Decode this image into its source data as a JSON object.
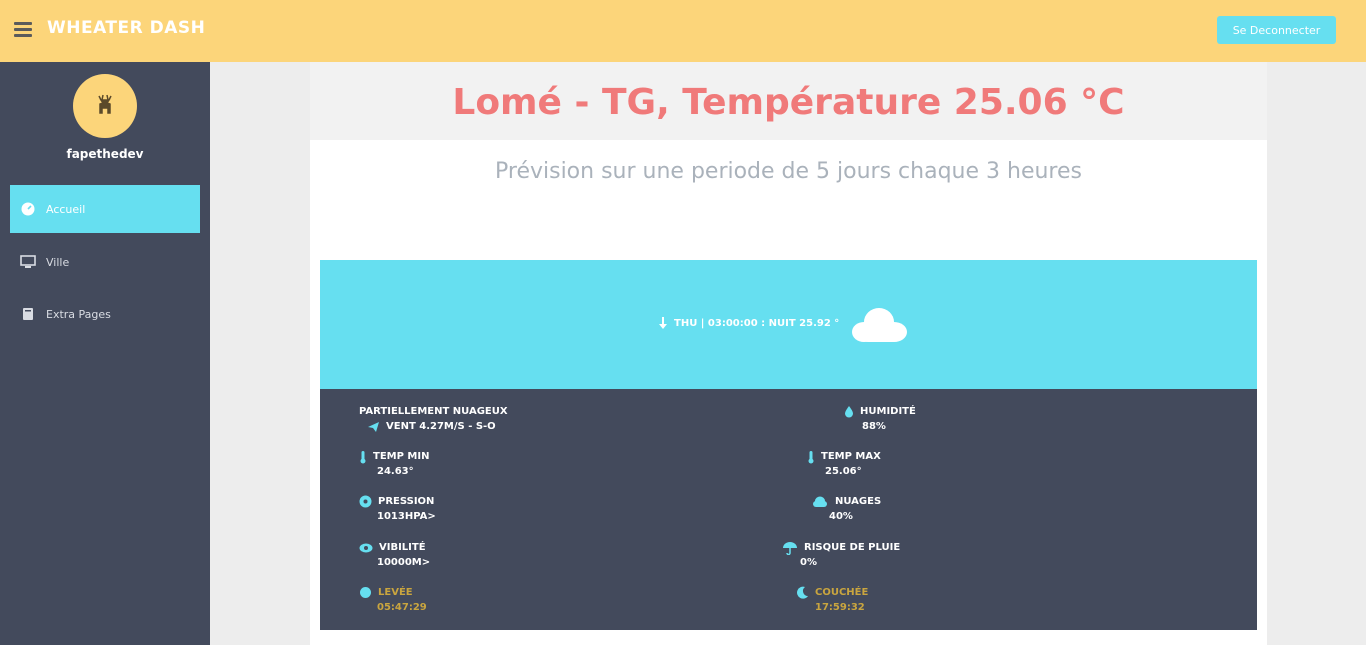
{
  "app": {
    "brand": "WHEATER DASH",
    "logout_label": "Se Deconnecter"
  },
  "sidebar": {
    "username": "fapethedev",
    "items": [
      {
        "label": "Accueil",
        "icon": "dashboard-icon",
        "active": true
      },
      {
        "label": "Ville",
        "icon": "monitor-icon",
        "active": false
      },
      {
        "label": "Extra Pages",
        "icon": "book-icon",
        "active": false
      }
    ]
  },
  "main": {
    "title": "Lomé - TG, Température 25.06 °C",
    "subtitle": "Prévision sur une periode de 5 jours chaque 3 heures"
  },
  "forecast": {
    "time_label": "THU | 03:00:00 : NUIT 25.92 °",
    "condition": "PARTIELLEMENT NUAGEUX",
    "wind": "VENT 4.27M/S - S-O",
    "humidity_label": "HUMIDITÉ",
    "humidity_value": "88%",
    "temp_min_label": "TEMP MIN",
    "temp_min_value": "24.63°",
    "temp_max_label": "TEMP MAX",
    "temp_max_value": "25.06°",
    "pressure_label": "PRESSION",
    "pressure_value": "1013HPA>",
    "clouds_label": "NUAGES",
    "clouds_value": "40%",
    "visibility_label": "VIBILITÉ",
    "visibility_value": "10000M>",
    "rain_label": "RISQUE DE PLUIE",
    "rain_value": "0%",
    "sunrise_label": "LEVÉE",
    "sunrise_value": "05:47:29",
    "sunset_label": "COUCHÉE",
    "sunset_value": "17:59:32"
  },
  "colors": {
    "topbar": "#fcd57a",
    "sidebar": "#434a5c",
    "accent": "#66dff0",
    "title": "#f07a7a"
  }
}
